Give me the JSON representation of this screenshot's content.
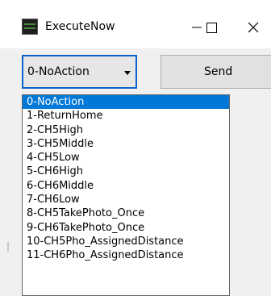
{
  "window": {
    "title": "ExecuteNow"
  },
  "icons": {
    "app": "app-icon",
    "minimize": "minimize-icon",
    "maximize": "maximize-icon",
    "close": "close-icon",
    "dropdown_arrow": "dropdown-arrow-icon"
  },
  "action_select": {
    "value": "0-NoAction",
    "options": [
      "0-NoAction",
      "1-ReturnHome",
      "2-CH5High",
      "3-CH5Middle",
      "4-CH5Low",
      "5-CH6High",
      "6-CH6Middle",
      "7-CH6Low",
      "8-CH5TakePhoto_Once",
      "9-CH6TakePhoto_Once",
      "10-CH5Pho_AssignedDistance",
      "11-CH6Pho_AssignedDistance"
    ],
    "selected_index": 0
  },
  "send_button": {
    "label": "Send"
  },
  "colors": {
    "accent": "#0078d7",
    "focus_border": "#0a64c8",
    "background": "#f0f0f0"
  }
}
